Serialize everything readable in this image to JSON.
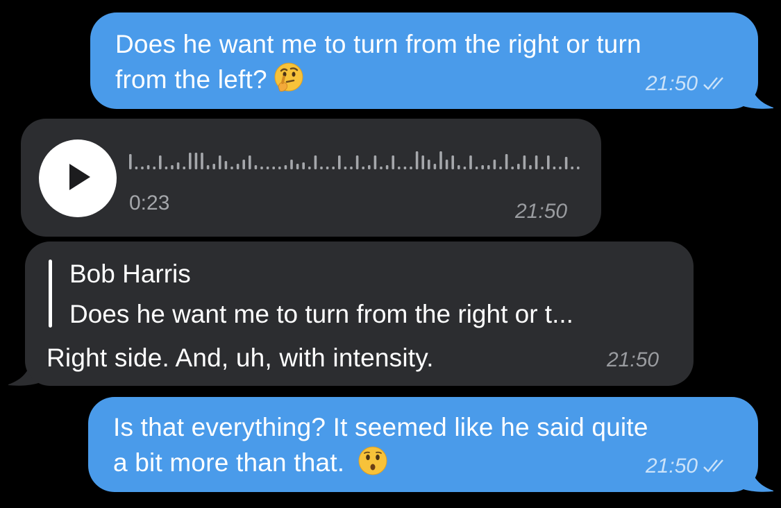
{
  "messages": [
    {
      "direction": "outgoing",
      "line1": "Does he want me to turn from the right or turn",
      "line2": "from the left?",
      "emoji": "thinking-face",
      "time": "21:50",
      "status": "read"
    },
    {
      "direction": "incoming",
      "type": "voice",
      "duration": "0:23",
      "time": "21:50"
    },
    {
      "direction": "incoming",
      "reply_to": {
        "sender": "Bob Harris",
        "preview": "Does he want me to turn from the right or t..."
      },
      "text": "Right side. And, uh, with intensity.",
      "time": "21:50"
    },
    {
      "direction": "outgoing",
      "line1": "Is that everything? It seemed like he said quite",
      "line2": "a bit more than that.",
      "emoji": "hushed-face",
      "time": "21:50",
      "status": "read"
    }
  ],
  "colors": {
    "background": "#000000",
    "outgoing_bubble": "#4a9bea",
    "incoming_bubble": "#2c2d30"
  }
}
